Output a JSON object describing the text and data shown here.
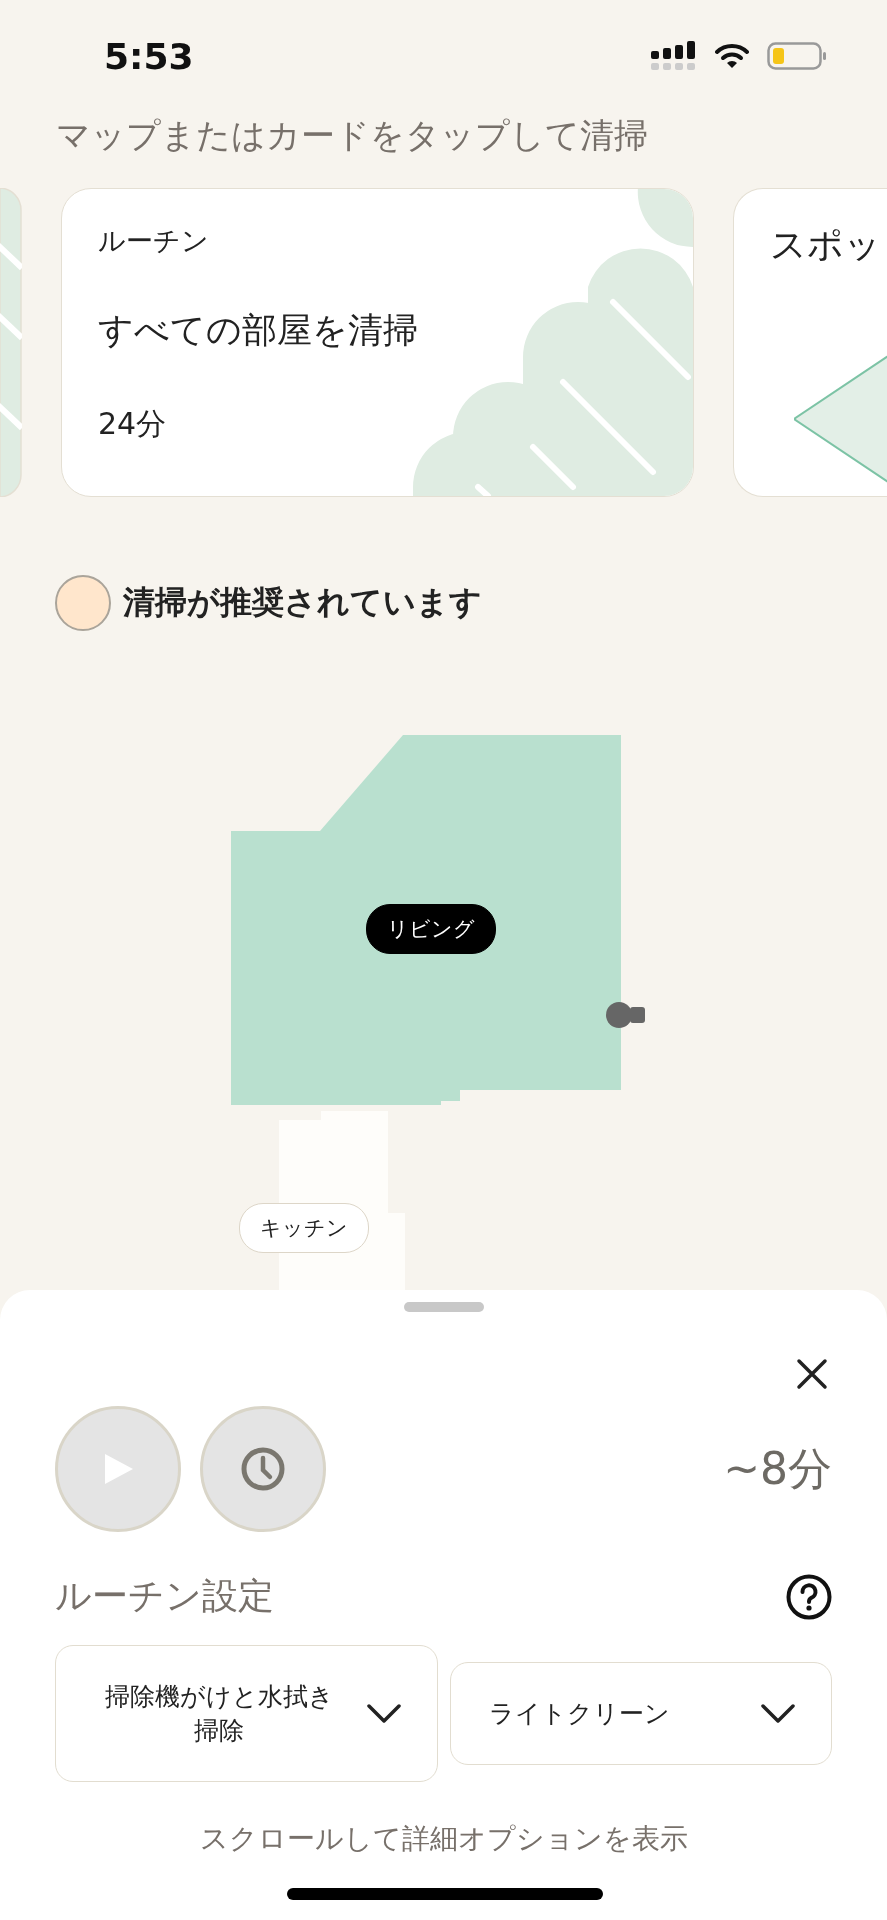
{
  "status_bar": {
    "time": "5:53"
  },
  "subtitle": "マップまたはカードをタップして清掃",
  "cards": [
    {
      "kind": "routine",
      "category": "ルーチン",
      "title": "すべての部屋を清掃",
      "duration": "24分"
    },
    {
      "kind": "spot",
      "category": "スポッ"
    }
  ],
  "legend": {
    "label": "清掃が推奨されています",
    "color": "#ffe6cc"
  },
  "map": {
    "rooms": [
      {
        "name": "リビング",
        "selected": true
      },
      {
        "name": "キッチン",
        "selected": false
      }
    ]
  },
  "sheet": {
    "actions": [
      {
        "kind": "play",
        "disabled": true
      },
      {
        "kind": "schedule",
        "disabled": true
      }
    ],
    "estimate": "~8分",
    "section_title": "ルーチン設定",
    "dropdowns": [
      {
        "value": "掃除機がけと水拭き掃除"
      },
      {
        "value": "ライトクリーン"
      }
    ],
    "footer": "スクロールして詳細オプションを表示"
  }
}
